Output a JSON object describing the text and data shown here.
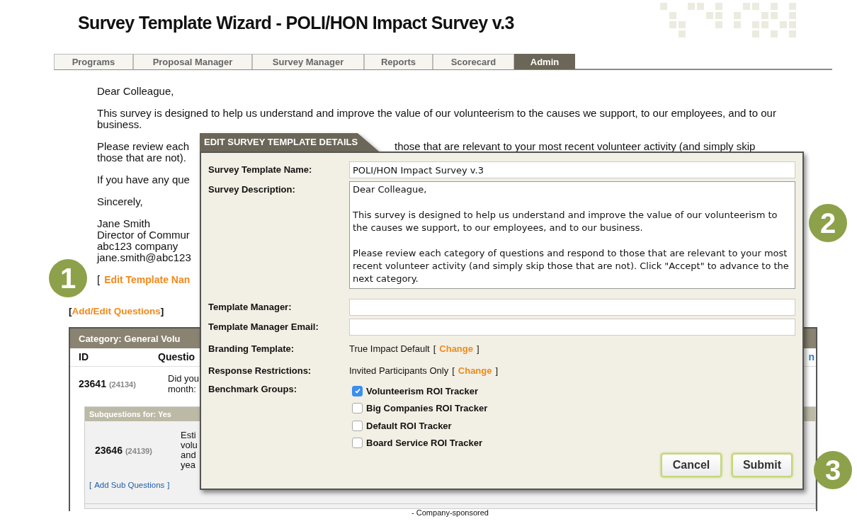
{
  "header": {
    "title": "Survey Template Wizard - POLI/HON Impact Survey v.3"
  },
  "nav_tabs": [
    {
      "label": "Programs",
      "selected": false
    },
    {
      "label": "Proposal Manager",
      "selected": false
    },
    {
      "label": "Survey Manager",
      "selected": false
    },
    {
      "label": "Reports",
      "selected": false
    },
    {
      "label": "Scorecard",
      "selected": false
    },
    {
      "label": "Admin",
      "selected": true
    }
  ],
  "letter": {
    "greeting": "Dear Colleague,",
    "paragraph_1": "This survey is designed to help us understand and improve the value of our volunteerism to the causes we support, to our employees, and to our business.",
    "paragraph_2_start": "Please review each",
    "paragraph_2_right": "those that are relevant to your most recent volunteer activity (and simply skip",
    "paragraph_2_end": "those that are not).",
    "paragraph_3": "If you have any que",
    "closing": "Sincerely,",
    "signature": [
      "Jane Smith",
      "Director of Commur",
      "abc123 company",
      "jane.smith@abc123"
    ],
    "edit_link": {
      "open": "[",
      "label": "Edit Template Nan"
    }
  },
  "add_edit_link": {
    "open": "[",
    "label": "Add/Edit Questions",
    "close": "]"
  },
  "category": {
    "title": "Category: General Volu",
    "columns": [
      "ID",
      "Questio"
    ],
    "column_end": "n",
    "question": {
      "id": "23641",
      "original_id": "(24134)",
      "text": [
        "Did you",
        "month:"
      ]
    },
    "subquestions": {
      "title": "Subquestions for: Yes",
      "id": "23646",
      "original_id": "(24139)",
      "text": [
        "Esti",
        "volu",
        "and",
        "yea"
      ],
      "add_link": {
        "open": "[",
        "label": "Add Sub Questions",
        "close": "]"
      }
    },
    "footer_text": "- Company-sponsored"
  },
  "callouts": [
    "1",
    "2",
    "3"
  ],
  "dialog": {
    "title": "EDIT SURVEY TEMPLATE DETAILS",
    "fields": [
      {
        "kind": "input",
        "label": "Survey Template Name:",
        "value": "POLI/HON Impact Survey v.3"
      },
      {
        "kind": "textarea",
        "label": "Survey Description:",
        "value": "Dear Colleague,\n\nThis survey is designed to help us understand and improve the value of our volunteerism to the causes we support, to our employees, and to our business.\n\nPlease review each category of questions and respond to those that are relevant to your most recent volunteer activity (and simply skip those that are not). Click \"Accept\" to advance to the next category."
      },
      {
        "kind": "input",
        "label": "Template Manager:"
      },
      {
        "kind": "input",
        "label": "Template Manager Email:"
      },
      {
        "kind": "change",
        "label": "Branding Template:",
        "value": "True Impact Default",
        "open": "[",
        "link": "Change",
        "close": "]"
      },
      {
        "kind": "change",
        "label": "Response Restrictions:",
        "value": "Invited Participants Only",
        "open": "[",
        "link": "Change",
        "close": "]"
      },
      {
        "kind": "checkboxes",
        "label": "Benchmark Groups:",
        "options": [
          {
            "label": "Volunteerism ROI Tracker",
            "checked": true
          },
          {
            "label": "Big Companies ROI Tracker",
            "checked": false
          },
          {
            "label": "Default ROI Tracker",
            "checked": false
          },
          {
            "label": "Board Service ROI Tracker",
            "checked": false
          }
        ]
      }
    ],
    "buttons": [
      "Cancel",
      "Submit"
    ]
  }
}
